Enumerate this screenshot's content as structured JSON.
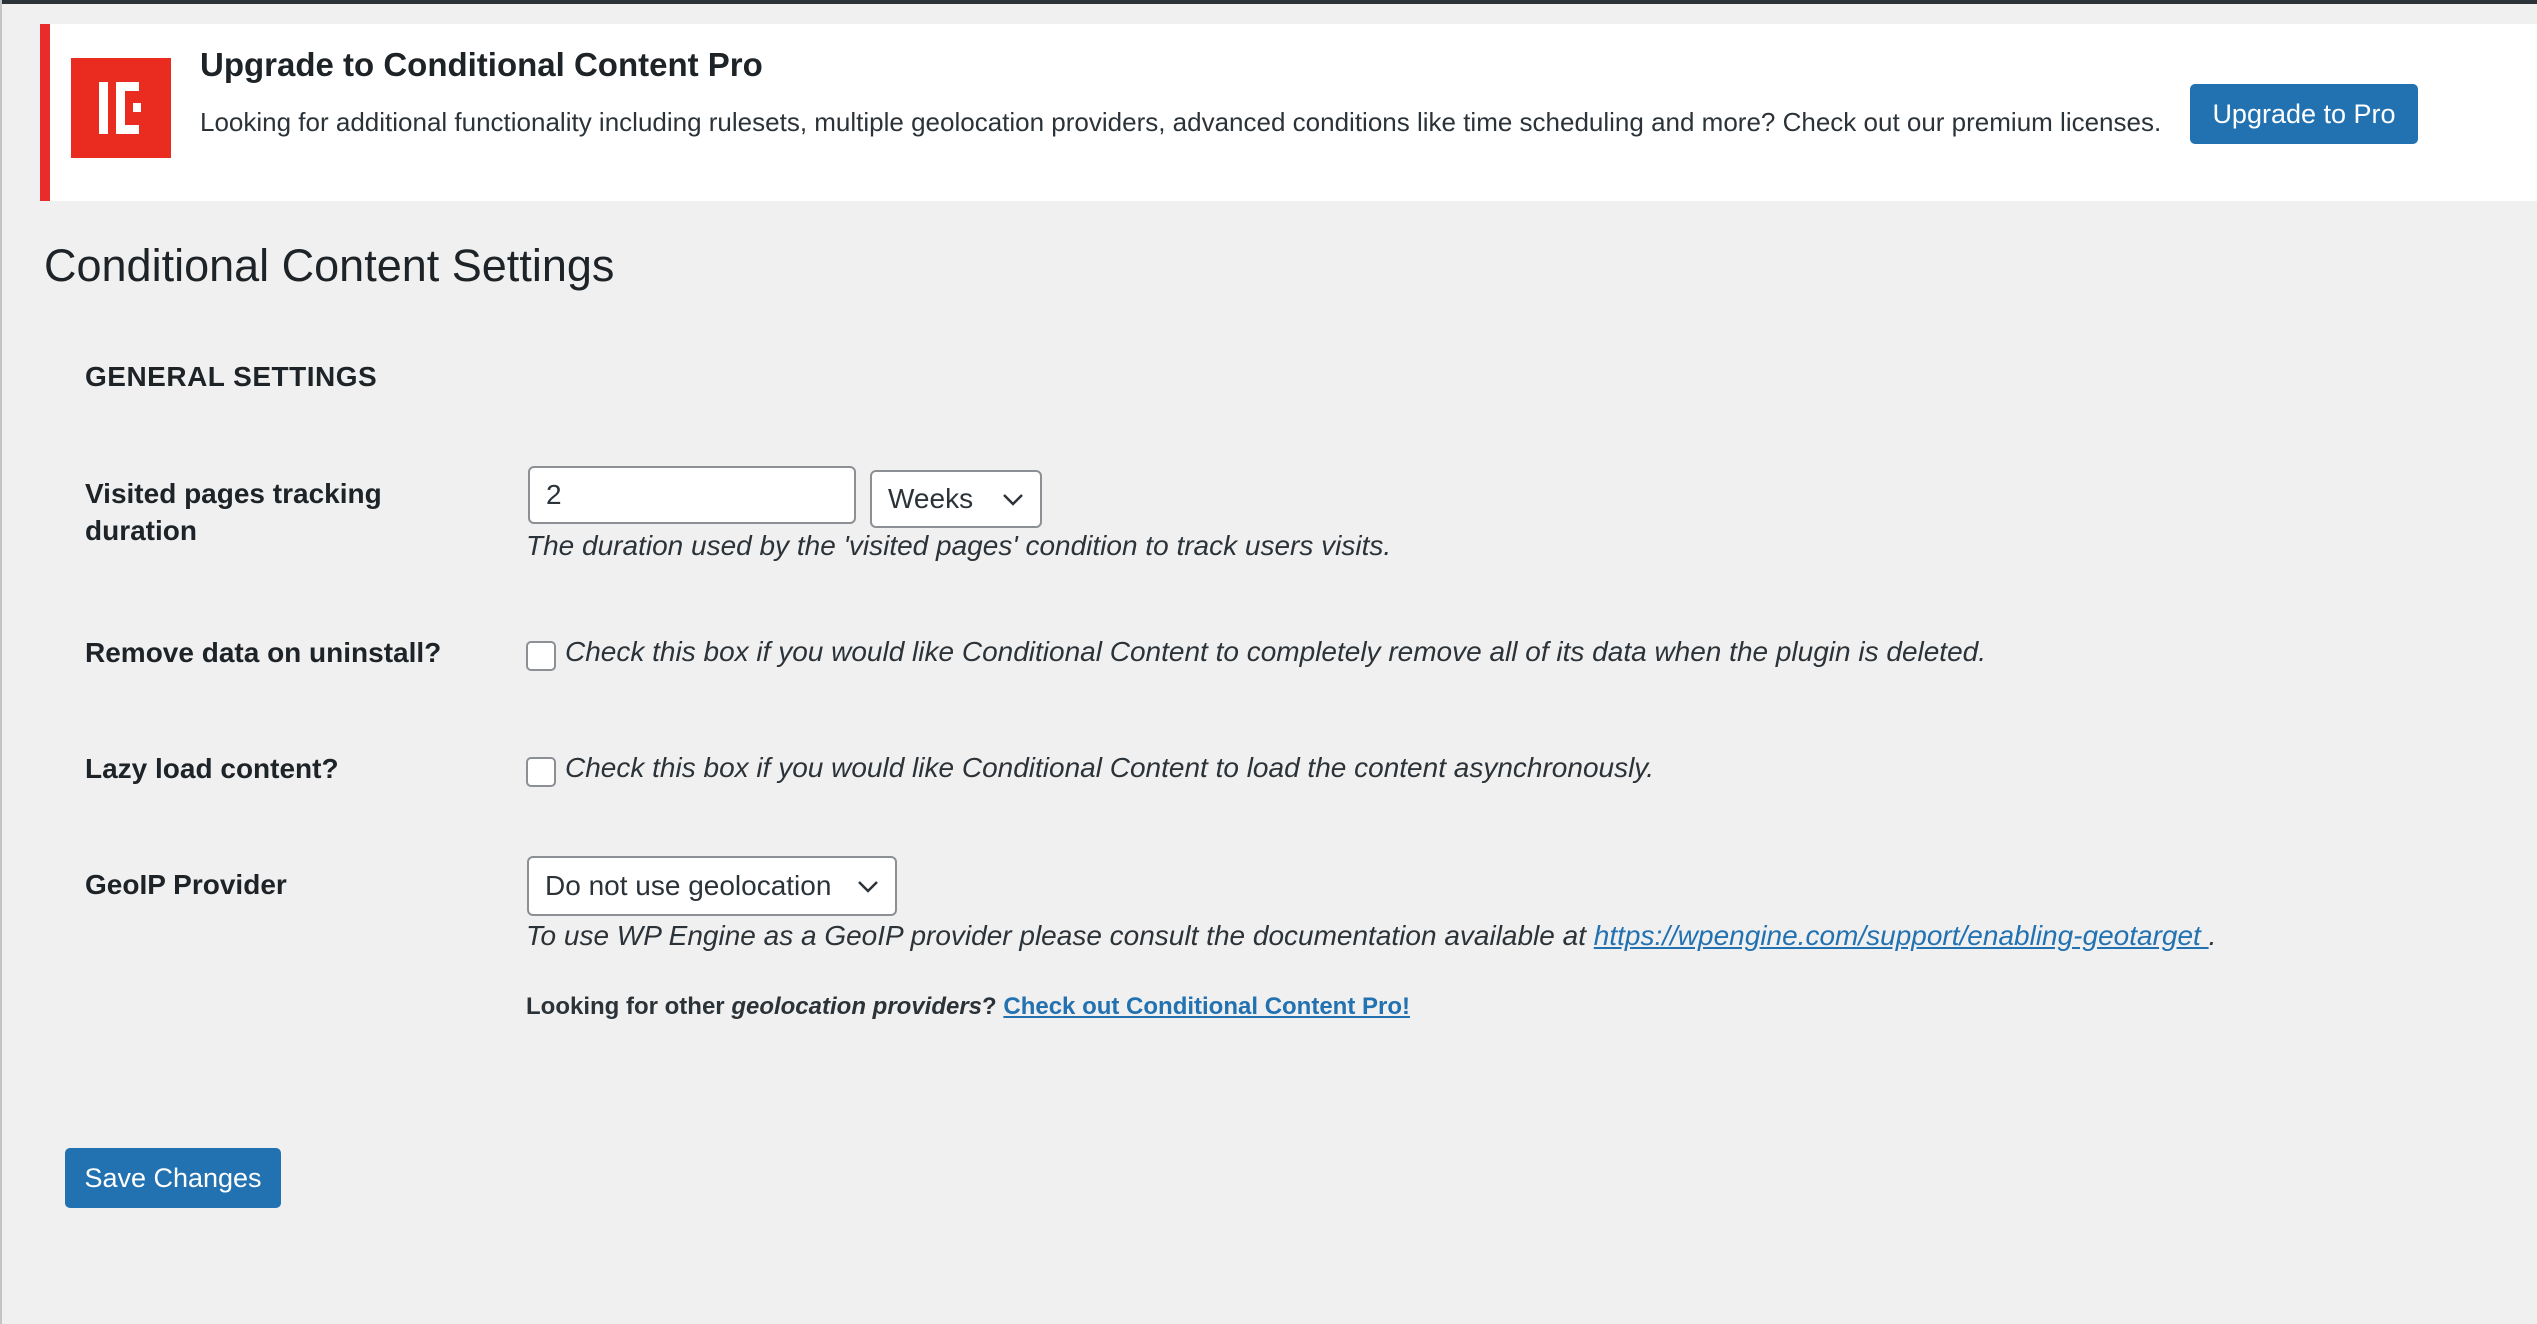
{
  "notice": {
    "title": "Upgrade to Conditional Content Pro",
    "text": "Looking for additional functionality including rulesets, multiple geolocation providers, advanced conditions like time scheduling and more? Check out our premium licenses.",
    "button_label": "Upgrade to Pro",
    "logo_icon": "conditional-content-logo",
    "accent_color": "#ea2b1f"
  },
  "page": {
    "title": "Conditional Content Settings",
    "section_title": "GENERAL SETTINGS"
  },
  "fields": {
    "tracking": {
      "label": "Visited pages tracking duration",
      "value": "2",
      "unit": "Weeks",
      "description": "The duration used by the 'visited pages' condition to track users visits."
    },
    "remove_data": {
      "label": "Remove data on uninstall?",
      "checked": false,
      "description": "Check this box if you would like Conditional Content to completely remove all of its data when the plugin is deleted."
    },
    "lazy_load": {
      "label": "Lazy load content?",
      "checked": false,
      "description": "Check this box if you would like Conditional Content to load the content asynchronously."
    },
    "geoip": {
      "label": "GeoIP Provider",
      "selected": "Do not use geolocation",
      "description_prefix": "To use WP Engine as a GeoIP provider please consult the documentation available at ",
      "doc_link": "https://wpengine.com/support/enabling-geotarget ",
      "description_suffix": ".",
      "note_prefix": "Looking for other ",
      "note_italic": "geolocation providers",
      "note_suffix": "? ",
      "pro_link": "Check out Conditional Content Pro!"
    }
  },
  "actions": {
    "save_label": "Save Changes"
  },
  "colors": {
    "primary": "#2271b1",
    "notice_border": "#ea2b2b",
    "background": "#f0f0f1"
  }
}
